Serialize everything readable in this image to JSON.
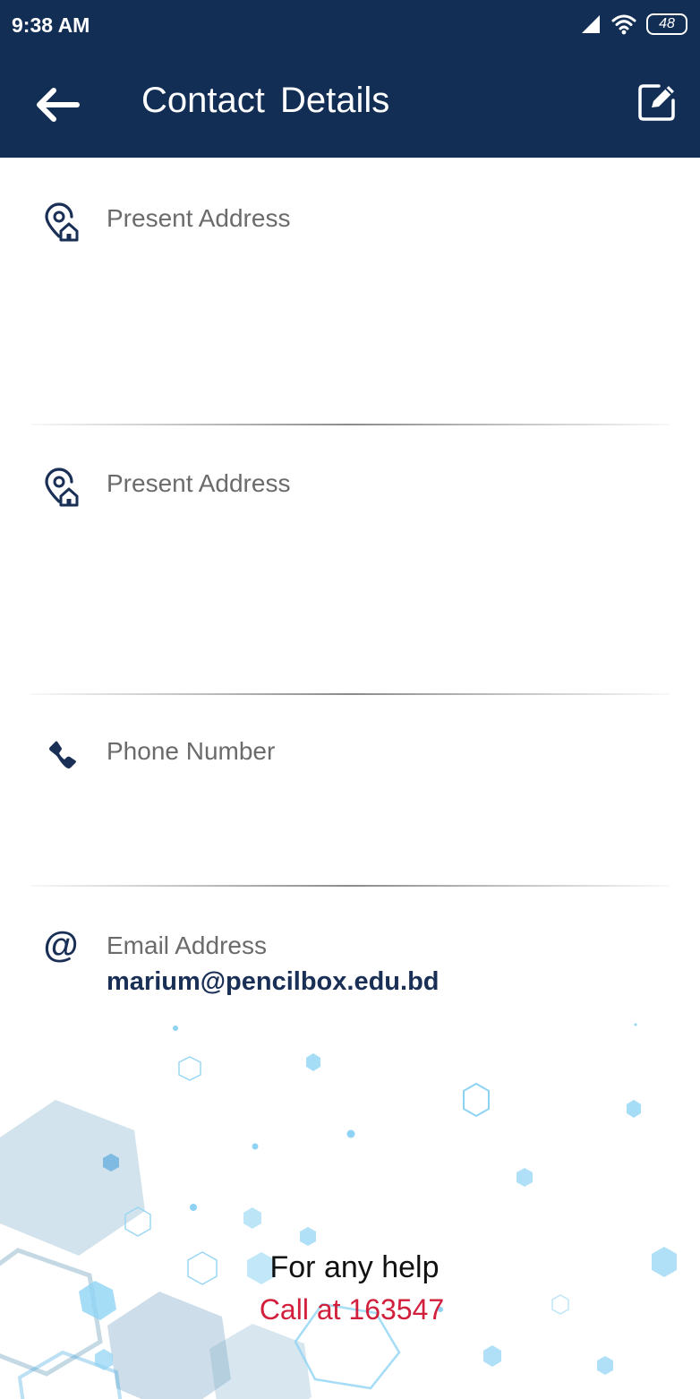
{
  "status_bar": {
    "time": "9:38 AM",
    "battery": "48",
    "icons": [
      "signal-icon",
      "wifi-icon",
      "battery-icon"
    ]
  },
  "app_bar": {
    "title": "Contact  Details",
    "back_icon": "arrow-left-icon",
    "edit_icon": "edit-icon"
  },
  "fields": {
    "present_address_1": {
      "label": "Present Address",
      "value": "",
      "icon": "location-home-icon"
    },
    "present_address_2": {
      "label": "Present Address",
      "value": "",
      "icon": "location-home-icon"
    },
    "phone": {
      "label": "Phone Number",
      "value": "",
      "icon": "phone-icon"
    },
    "email": {
      "label": "Email Address",
      "value": "marium@pencilbox.edu.bd",
      "icon": "at-icon"
    }
  },
  "help": {
    "title": "For any help",
    "call": "Call at 163547"
  },
  "colors": {
    "header_bg": "#132e54",
    "icon_color": "#1a2f56",
    "label_color": "#6b6b6b",
    "call_color": "#d21f3c",
    "decor_color": "#8fd3f4"
  }
}
